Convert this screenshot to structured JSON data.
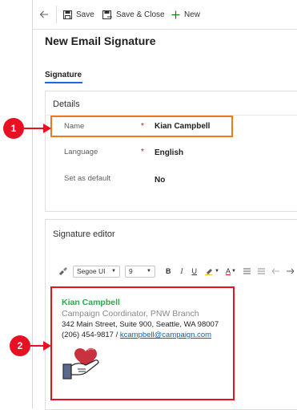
{
  "toolbar": {
    "back_icon": "back-arrow-icon",
    "save_label": "Save",
    "save_close_label": "Save & Close",
    "new_label": "New"
  },
  "page": {
    "title": "New Email Signature",
    "tab_label": "Signature"
  },
  "details": {
    "section_title": "Details",
    "fields": [
      {
        "label": "Name",
        "required": true,
        "value": "Kian Campbell"
      },
      {
        "label": "Language",
        "required": true,
        "value": "English"
      },
      {
        "label": "Set as default",
        "required": false,
        "value": "No"
      }
    ],
    "required_marker": "*"
  },
  "editor": {
    "section_title": "Signature editor",
    "font_family": "Segoe UI",
    "font_size": "9",
    "format_buttons": {
      "bold": "B",
      "italic": "I",
      "underline": "U",
      "font_color": "A"
    },
    "signature": {
      "name": "Kian Campbell",
      "role": "Campaign Coordinator, PNW Branch",
      "address": "342 Main Street, Suite 900, Seattle, WA 98007",
      "phone": "(206) 454-9817",
      "separator": " / ",
      "email": "kcampbell@campaign.com",
      "image_icon": "hand-holding-heart-icon"
    }
  },
  "callouts": {
    "one": "1",
    "two": "2"
  },
  "colors": {
    "callout_red": "#e81123",
    "highlight_orange": "#f07a1b",
    "tab_underline": "#2266e3",
    "signature_name": "#2aa84a"
  }
}
